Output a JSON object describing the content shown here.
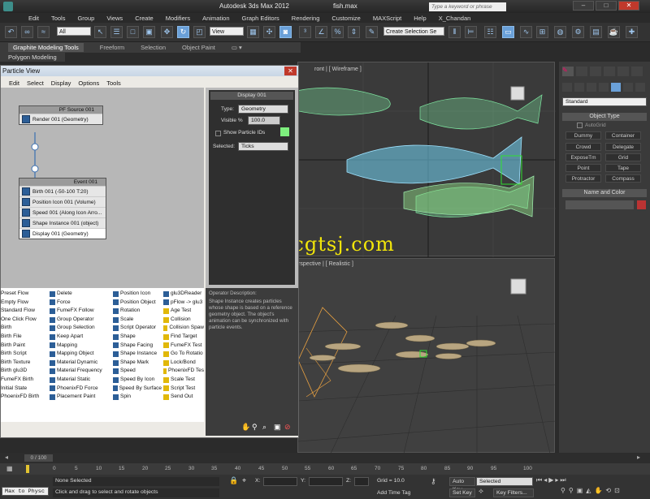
{
  "titlebar": {
    "app": "Autodesk 3ds Max  2012",
    "file": "fish.max",
    "search_placeholder": "Type a keyword or phrase"
  },
  "menus": [
    "Edit",
    "Tools",
    "Group",
    "Views",
    "Create",
    "Modifiers",
    "Animation",
    "Graph Editors",
    "Rendering",
    "Customize",
    "MAXScript",
    "Help",
    "X_Chandan"
  ],
  "toolbar": {
    "filter": "All",
    "refcoord": "View",
    "selection_set": "Create Selection Se"
  },
  "ribbon": {
    "tabs": [
      "Graphite Modeling Tools",
      "Freeform",
      "Selection",
      "Object Paint"
    ],
    "sub": "Polygon Modeling"
  },
  "viewports": {
    "top_label": "ront | [ Wireframe ]",
    "persp_label": "rspective | [ Realistic ]"
  },
  "watermark": "www.cgtsj.com",
  "command_panel": {
    "dropdown": "Standard",
    "object_type_header": "Object Type",
    "autogrid": "AutoGrid",
    "buttons": [
      "Dummy",
      "Container",
      "Crowd",
      "Delegate",
      "ExposeTm",
      "Grid",
      "Point",
      "Tape",
      "Protractor",
      "Compass"
    ],
    "name_color_header": "Name and Color"
  },
  "particle_view": {
    "title": "Particle View",
    "menu": [
      "Edit",
      "Select",
      "Display",
      "Options",
      "Tools"
    ],
    "pf_source": {
      "header": "PF Source 001",
      "render": "Render 001 (Geometry)"
    },
    "event": {
      "header": "Event 001",
      "operators": [
        "Birth 001 (-50-100 T:20)",
        "Position Icon 001 (Volume)",
        "Speed 001 (Along Icon Arro...",
        "Shape Instance 001 (object)",
        "Display 001 (Geometry)"
      ]
    },
    "params": {
      "header": "Display 001",
      "type_label": "Type:",
      "type_value": "Geometry",
      "visible_label": "Visible %",
      "visible_value": "100.0",
      "show_ids": "Show Particle IDs",
      "selected_label": "Selected:",
      "selected_value": "Ticks"
    },
    "description": {
      "title": "Operator Description:",
      "text": "Shape Instance creates particles whose shape is based on a reference geometry object. The object's animation can be synchronized with particle events."
    },
    "depot": {
      "col1": [
        "Preset Flow",
        "Empty Flow",
        "Standard Flow",
        "One Click Flow",
        "Birth",
        "Birth File",
        "Birth Paint",
        "Birth Script",
        "Birth Texture",
        "Birth glu3D",
        "FumeFX Birth",
        "Initial State",
        "PhoenixFD Birth"
      ],
      "col2": [
        "Delete",
        "Force",
        "FumeFX Follow",
        "Group Operator",
        "Group Selection",
        "Keep Apart",
        "Mapping",
        "Mapping Object",
        "Material Dynamic",
        "Material Frequency",
        "Material Static",
        "PhoenixFD Force",
        "Placement Paint"
      ],
      "col3": [
        "Position Icon",
        "Position Object",
        "Rotation",
        "Scale",
        "Script Operator",
        "Shape",
        "Shape Facing",
        "Shape Instance",
        "Shape Mark",
        "Speed",
        "Speed By Icon",
        "Speed By Surface",
        "Spin"
      ],
      "col4": [
        "glu3DReader",
        "pFlow -> glu3",
        "Age Test",
        "Collision",
        "Collision Spaw",
        "Find Target",
        "FumeFX Test",
        "Go To Rotatio",
        "Lock/Bond",
        "PhoenixFD Tes",
        "Scale Test",
        "Script Test",
        "Send Out"
      ]
    }
  },
  "timeline": {
    "slider": "0 / 100",
    "ticks": [
      "0",
      "5",
      "10",
      "15",
      "20",
      "25",
      "30",
      "35",
      "40",
      "45",
      "50",
      "55",
      "60",
      "65",
      "70",
      "75",
      "80",
      "85",
      "90",
      "95",
      "100"
    ]
  },
  "status": {
    "script": "Max to Physc",
    "selection": "None Selected",
    "prompt": "Click and drag to select and rotate objects",
    "x_label": "X:",
    "y_label": "Y:",
    "z_label": "Z:",
    "grid": "Grid = 10.0",
    "add_time_tag": "Add Time Tag",
    "auto_key": "Auto Key",
    "set_key": "Set Key",
    "selected_value": "Selected",
    "key_filters": "Key Filters..."
  }
}
